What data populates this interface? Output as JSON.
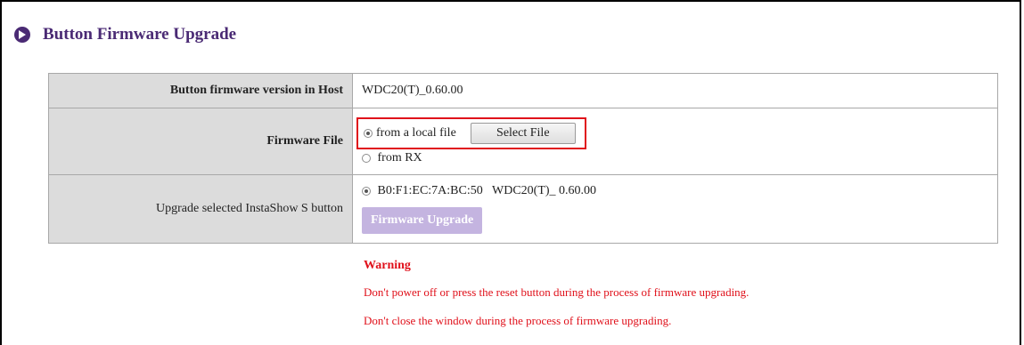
{
  "section": {
    "title": "Button Firmware Upgrade",
    "icon": "play-circle-icon",
    "accent_color": "#4a2a74"
  },
  "rows": {
    "host_version": {
      "label": "Button firmware version in Host",
      "value": "WDC20(T)_0.60.00"
    },
    "firmware_file": {
      "label": "Firmware File",
      "option_local": "from a local file",
      "option_local_selected": true,
      "select_button": "Select File",
      "option_rx": "from RX",
      "option_rx_selected": false
    },
    "upgrade_button": {
      "label": "Upgrade selected InstaShow S button",
      "device": "B0:F1:EC:7A:BC:50   WDC20(T)_ 0.60.00",
      "device_selected": true,
      "upgrade_label": "Firmware Upgrade",
      "upgrade_enabled": false
    }
  },
  "warning": {
    "title": "Warning",
    "lines": [
      "Don't power off or press the reset button during the process of firmware upgrading.",
      "Don't close the window during the process of firmware upgrading."
    ],
    "color": "#e0101a"
  },
  "highlight_color": "#e0101a"
}
